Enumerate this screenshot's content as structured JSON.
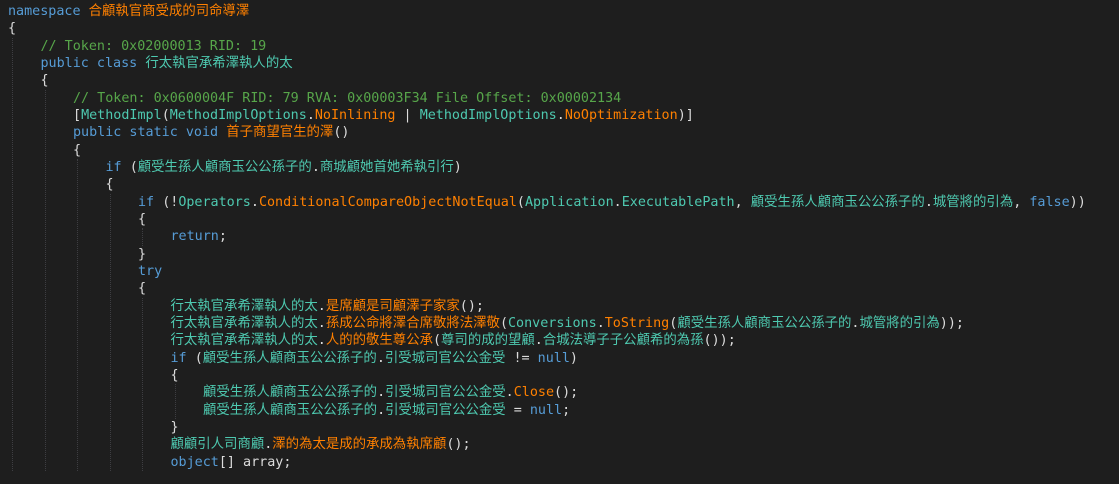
{
  "lines": [
    {
      "indent": 0,
      "tokens": [
        [
          "kw",
          "namespace "
        ],
        [
          "mem",
          "合顧執官商受成的司命導澤"
        ]
      ]
    },
    {
      "indent": 0,
      "tokens": [
        [
          "pl",
          "{"
        ]
      ]
    },
    {
      "indent": 1,
      "tokens": [
        [
          "cm",
          "// Token: 0x02000013 RID: 19"
        ]
      ]
    },
    {
      "indent": 1,
      "tokens": [
        [
          "kw",
          "public class "
        ],
        [
          "ty",
          "行太執官承希澤執人的太"
        ]
      ]
    },
    {
      "indent": 1,
      "tokens": [
        [
          "pl",
          "{"
        ]
      ]
    },
    {
      "indent": 2,
      "tokens": [
        [
          "cm",
          "// Token: 0x0600004F RID: 79 RVA: 0x00003F34 File Offset: 0x00002134"
        ]
      ]
    },
    {
      "indent": 2,
      "tokens": [
        [
          "pl",
          "["
        ],
        [
          "ty",
          "MethodImpl"
        ],
        [
          "pl",
          "("
        ],
        [
          "ty",
          "MethodImplOptions"
        ],
        [
          "pl",
          "."
        ],
        [
          "mem",
          "NoInlining"
        ],
        [
          "pl",
          " | "
        ],
        [
          "ty",
          "MethodImplOptions"
        ],
        [
          "pl",
          "."
        ],
        [
          "mem",
          "NoOptimization"
        ],
        [
          "pl",
          ")]"
        ]
      ]
    },
    {
      "indent": 2,
      "tokens": [
        [
          "kw",
          "public static void "
        ],
        [
          "mem",
          "首子商望官生的澤"
        ],
        [
          "pl",
          "()"
        ]
      ]
    },
    {
      "indent": 2,
      "tokens": [
        [
          "pl",
          "{"
        ]
      ]
    },
    {
      "indent": 3,
      "tokens": [
        [
          "kw",
          "if "
        ],
        [
          "pl",
          "("
        ],
        [
          "ty",
          "顧受生孫人顧商玉公公孫子的"
        ],
        [
          "pl",
          "."
        ],
        [
          "ty",
          "商城顧她首她希執引行"
        ],
        [
          "pl",
          ")"
        ]
      ]
    },
    {
      "indent": 3,
      "tokens": [
        [
          "pl",
          "{"
        ]
      ]
    },
    {
      "indent": 4,
      "tokens": [
        [
          "kw",
          "if "
        ],
        [
          "pl",
          "(!"
        ],
        [
          "ty",
          "Operators"
        ],
        [
          "pl",
          "."
        ],
        [
          "mem",
          "ConditionalCompareObjectNotEqual"
        ],
        [
          "pl",
          "("
        ],
        [
          "ty",
          "Application"
        ],
        [
          "pl",
          "."
        ],
        [
          "ty",
          "ExecutablePath"
        ],
        [
          "pl",
          ", "
        ],
        [
          "ty",
          "顧受生孫人顧商玉公公孫子的"
        ],
        [
          "pl",
          "."
        ],
        [
          "ty",
          "城管將的引為"
        ],
        [
          "pl",
          ", "
        ],
        [
          "kw",
          "false"
        ],
        [
          "pl",
          "))"
        ]
      ]
    },
    {
      "indent": 4,
      "tokens": [
        [
          "pl",
          "{"
        ]
      ]
    },
    {
      "indent": 5,
      "tokens": [
        [
          "kw",
          "return"
        ],
        [
          "pl",
          ";"
        ]
      ]
    },
    {
      "indent": 4,
      "tokens": [
        [
          "pl",
          "}"
        ]
      ]
    },
    {
      "indent": 4,
      "tokens": [
        [
          "kw",
          "try"
        ]
      ]
    },
    {
      "indent": 4,
      "tokens": [
        [
          "pl",
          "{"
        ]
      ]
    },
    {
      "indent": 5,
      "tokens": [
        [
          "ty",
          "行太執官承希澤執人的太"
        ],
        [
          "pl",
          "."
        ],
        [
          "mem",
          "是席顧是司顧澤子家家"
        ],
        [
          "pl",
          "();"
        ]
      ]
    },
    {
      "indent": 5,
      "tokens": [
        [
          "ty",
          "行太執官承希澤執人的太"
        ],
        [
          "pl",
          "."
        ],
        [
          "mem",
          "孫成公命將澤合席敬將法澤敬"
        ],
        [
          "pl",
          "("
        ],
        [
          "ty",
          "Conversions"
        ],
        [
          "pl",
          "."
        ],
        [
          "mem",
          "ToString"
        ],
        [
          "pl",
          "("
        ],
        [
          "ty",
          "顧受生孫人顧商玉公公孫子的"
        ],
        [
          "pl",
          "."
        ],
        [
          "ty",
          "城管將的引為"
        ],
        [
          "pl",
          "));"
        ]
      ]
    },
    {
      "indent": 5,
      "tokens": [
        [
          "ty",
          "行太執官承希澤執人的太"
        ],
        [
          "pl",
          "."
        ],
        [
          "mem",
          "人的的敬生尊公承"
        ],
        [
          "pl",
          "("
        ],
        [
          "ty",
          "尊司的成的望顧"
        ],
        [
          "pl",
          "."
        ],
        [
          "ty",
          "合城法導子子公顧希的為孫"
        ],
        [
          "pl",
          "());"
        ]
      ]
    },
    {
      "indent": 5,
      "tokens": [
        [
          "kw",
          "if "
        ],
        [
          "pl",
          "("
        ],
        [
          "ty",
          "顧受生孫人顧商玉公公孫子的"
        ],
        [
          "pl",
          "."
        ],
        [
          "ty",
          "引受城司官公公金受"
        ],
        [
          "pl",
          " != "
        ],
        [
          "kw",
          "null"
        ],
        [
          "pl",
          ")"
        ]
      ]
    },
    {
      "indent": 5,
      "tokens": [
        [
          "pl",
          "{"
        ]
      ]
    },
    {
      "indent": 6,
      "tokens": [
        [
          "ty",
          "顧受生孫人顧商玉公公孫子的"
        ],
        [
          "pl",
          "."
        ],
        [
          "ty",
          "引受城司官公公金受"
        ],
        [
          "pl",
          "."
        ],
        [
          "mem",
          "Close"
        ],
        [
          "pl",
          "();"
        ]
      ]
    },
    {
      "indent": 6,
      "tokens": [
        [
          "ty",
          "顧受生孫人顧商玉公公孫子的"
        ],
        [
          "pl",
          "."
        ],
        [
          "ty",
          "引受城司官公公金受"
        ],
        [
          "pl",
          " = "
        ],
        [
          "kw",
          "null"
        ],
        [
          "pl",
          ";"
        ]
      ]
    },
    {
      "indent": 5,
      "tokens": [
        [
          "pl",
          "}"
        ]
      ]
    },
    {
      "indent": 5,
      "tokens": [
        [
          "ty",
          "顧顧引人司商顧"
        ],
        [
          "pl",
          "."
        ],
        [
          "mem",
          "澤的為太是成的承成為執席顧"
        ],
        [
          "pl",
          "();"
        ]
      ]
    },
    {
      "indent": 5,
      "tokens": [
        [
          "kw",
          "object"
        ],
        [
          "pl",
          "[] array;"
        ]
      ]
    }
  ]
}
